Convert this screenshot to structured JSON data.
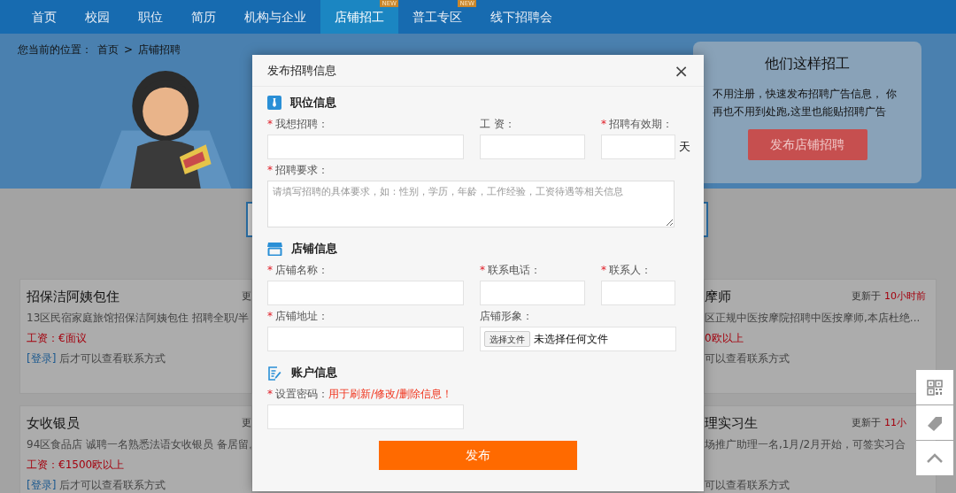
{
  "nav": {
    "items": [
      {
        "label": "首页",
        "selected": false
      },
      {
        "label": "校园",
        "selected": false
      },
      {
        "label": "职位",
        "selected": false
      },
      {
        "label": "简历",
        "selected": false
      },
      {
        "label": "机构与企业",
        "selected": false
      },
      {
        "label": "店铺招工",
        "selected": true,
        "badge": "NEW"
      },
      {
        "label": "普工专区",
        "selected": false,
        "badge": "NEW"
      },
      {
        "label": "线下招聘会",
        "selected": false
      }
    ]
  },
  "breadcrumb": {
    "prefix": "您当前的位置：",
    "separator": ">",
    "items": [
      "首页",
      "店铺招聘"
    ]
  },
  "promo": {
    "title": "他们这样招工",
    "text": "不用注册，快速发布招聘广告信息， 你再也不用到处跑,这里也能贴招聘广告",
    "button": "发布店铺招聘"
  },
  "listings": {
    "left": [
      {
        "title": "招保洁阿姨包住",
        "update": "更",
        "desc": "13区民宿家庭旅馆招保洁阿姨包住 招聘全职/半",
        "salary": "工资：€面议",
        "login": "[登录]",
        "contact": "后才可以查看联系方式"
      },
      {
        "title": "女收银员",
        "update": "更",
        "desc": "94区食品店 诚聘一名熟悉法语女收银员 备居留。",
        "salary": "工资：€1500欧以上",
        "login": "[登录]",
        "contact": "后才可以查看联系方式"
      }
    ],
    "right": [
      {
        "title": "摩师",
        "update": "更新于",
        "time": "10小时前",
        "desc": "区正规中医按摩院招聘中医按摩师,本店杜绝...",
        "salary": "0欧以上",
        "contact": "可以查看联系方式"
      },
      {
        "title": "理实习生",
        "update": "更新于",
        "time": "11小",
        "desc": "场推广助理一名,1月/2月开始，可签实习合",
        "contact": "可以查看联系方式"
      }
    ]
  },
  "modal": {
    "title": "发布招聘信息",
    "close": "×",
    "submit": "发布",
    "required_mark": "*",
    "sections": [
      {
        "title": "职位信息",
        "rows": [
          [
            {
              "label": "我想招聘：",
              "required": true,
              "kind": "text"
            },
            {
              "label": "工 资：",
              "required": false,
              "kind": "text"
            },
            {
              "label": "招聘有效期：",
              "required": true,
              "kind": "text",
              "suffix": "天"
            }
          ],
          [
            {
              "label": "招聘要求：",
              "required": true,
              "kind": "textarea",
              "placeholder": "请填写招聘的具体要求，如：性别，学历，年龄，工作经验，工资待遇等相关信息"
            }
          ]
        ]
      },
      {
        "title": "店铺信息",
        "rows": [
          [
            {
              "label": "店铺名称：",
              "required": true,
              "kind": "text"
            },
            {
              "label": "联系电话：",
              "required": true,
              "kind": "text"
            },
            {
              "label": "联系人：",
              "required": true,
              "kind": "text"
            }
          ],
          [
            {
              "label": "店铺地址：",
              "required": true,
              "kind": "text"
            },
            {
              "label": "店铺形象：",
              "required": false,
              "kind": "file",
              "button": "选择文件",
              "status": "未选择任何文件"
            }
          ]
        ]
      },
      {
        "title": "账户信息",
        "rows": [
          [
            {
              "label": "设置密码：",
              "required": true,
              "kind": "password",
              "hint": "用于刷新/修改/删除信息！"
            }
          ]
        ]
      }
    ]
  }
}
